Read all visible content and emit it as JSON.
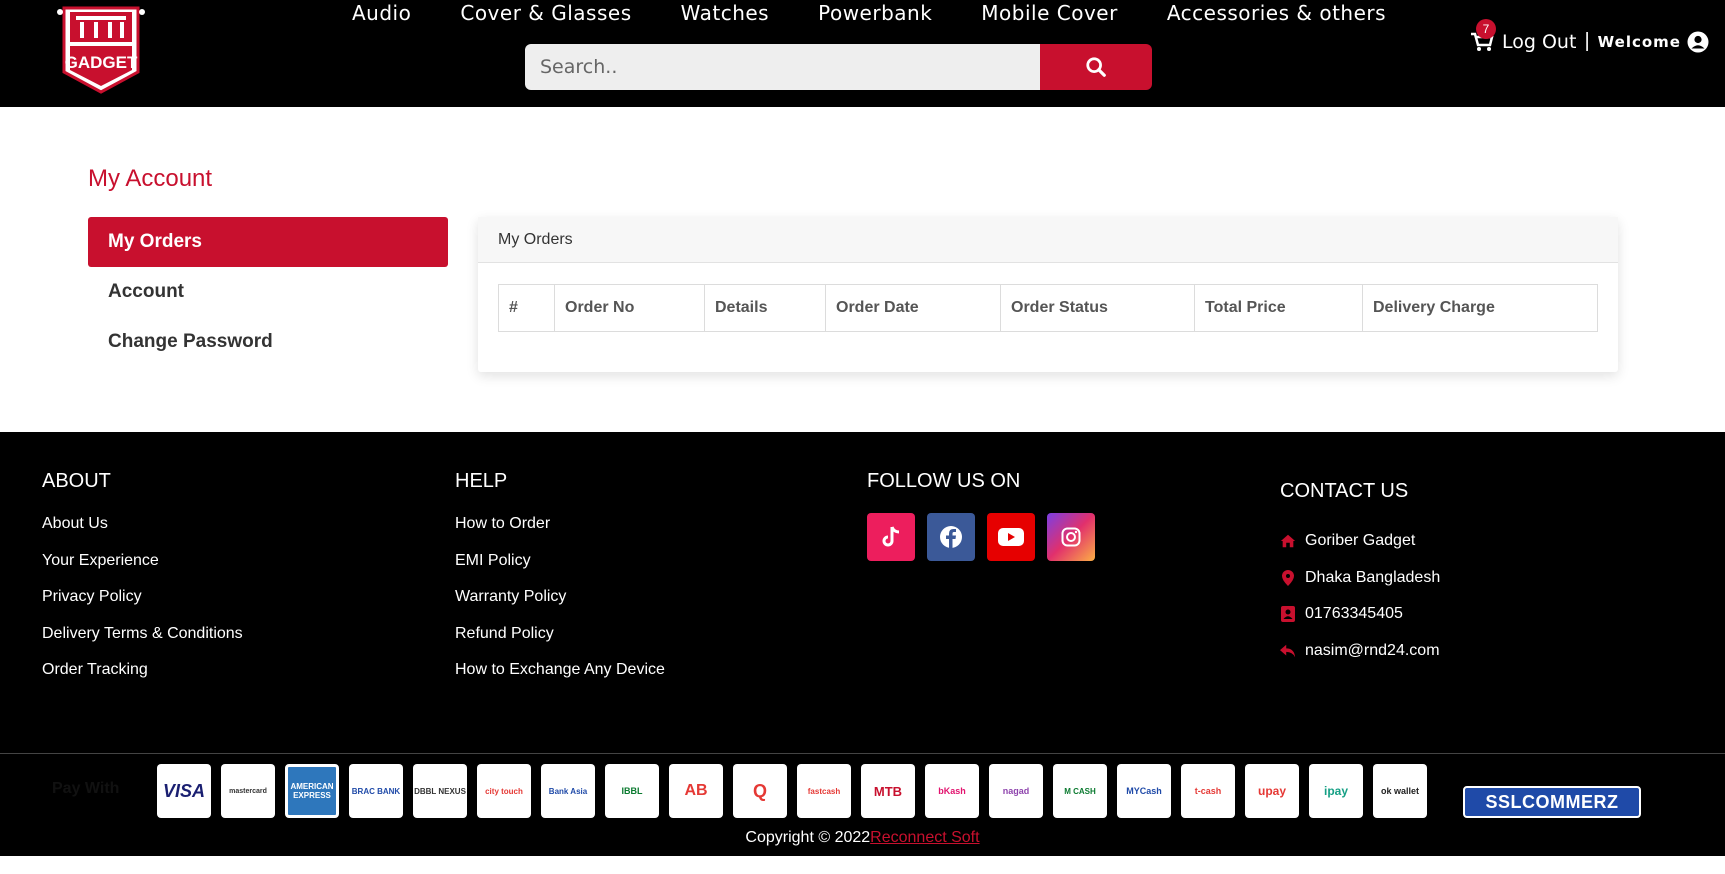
{
  "header": {
    "logo_text": "GADGET",
    "nav": [
      "Audio",
      "Cover & Glasses",
      "Watches",
      "Powerbank",
      "Mobile Cover",
      "Accessories & others"
    ],
    "search_placeholder": "Search..",
    "cart_count": "7",
    "logout": "Log Out",
    "separator": "|",
    "welcome": "Welcome"
  },
  "account": {
    "title": "My Account",
    "menu": [
      "My Orders",
      "Account",
      "Change Password"
    ],
    "card_title": "My Orders",
    "columns": [
      "#",
      "Order No",
      "Details",
      "Order Date",
      "Order Status",
      "Total Price",
      "Delivery Charge"
    ]
  },
  "footer": {
    "about": {
      "heading": "ABOUT",
      "links": [
        "About Us",
        "Your Experience",
        "Privacy Policy",
        "Delivery Terms & Conditions",
        "Order Tracking"
      ]
    },
    "help": {
      "heading": "HELP",
      "links": [
        "How to Order",
        "EMI Policy",
        "Warranty Policy",
        "Refund Policy",
        "How to Exchange Any Device"
      ]
    },
    "follow": {
      "heading": "FOLLOW US ON",
      "icons": [
        "tiktok-icon",
        "facebook-icon",
        "youtube-icon",
        "instagram-icon"
      ]
    },
    "contact": {
      "heading": "CONTACT US",
      "items": [
        "Goriber Gadget",
        "Dhaka Bangladesh",
        "01763345405",
        "nasim@rnd24.com"
      ]
    },
    "pay_with": "Pay With",
    "pay_logos": [
      "VISA",
      "mastercard",
      "AMERICAN EXPRESS",
      "BRAC BANK",
      "DBBL NEXUS",
      "city touch",
      "Bank Asia",
      "IBBL",
      "AB",
      "Q",
      "fastcash",
      "MTB",
      "bKash",
      "nagad",
      "M CASH",
      "MYCash",
      "t-cash",
      "upay",
      "ipay",
      "ok wallet"
    ],
    "ssl": "SSLCOMMERZ",
    "copyright_prefix": "Copyright © 2022",
    "copyright_link": "Reconnect Soft"
  },
  "colors": {
    "brand": "#c8102e",
    "header_bg": "#000000"
  }
}
